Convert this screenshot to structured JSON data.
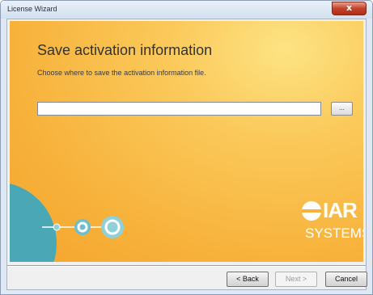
{
  "window": {
    "title": "License Wizard",
    "close_glyph": "x"
  },
  "page": {
    "heading": "Save activation information",
    "subheading": "Choose where to save the activation information file."
  },
  "file_path": {
    "value": "",
    "placeholder": ""
  },
  "browse_button": {
    "label": "..."
  },
  "logo": {
    "line1": "IAR",
    "line2": "SYSTEMS"
  },
  "buttons": {
    "back": "< Back",
    "next": "Next >",
    "cancel": "Cancel"
  },
  "colors": {
    "banner_orange": "#f7b23b",
    "banner_yellow": "#fde383",
    "circle_teal": "#4aa8b6",
    "light_teal": "#8fd0d9"
  }
}
